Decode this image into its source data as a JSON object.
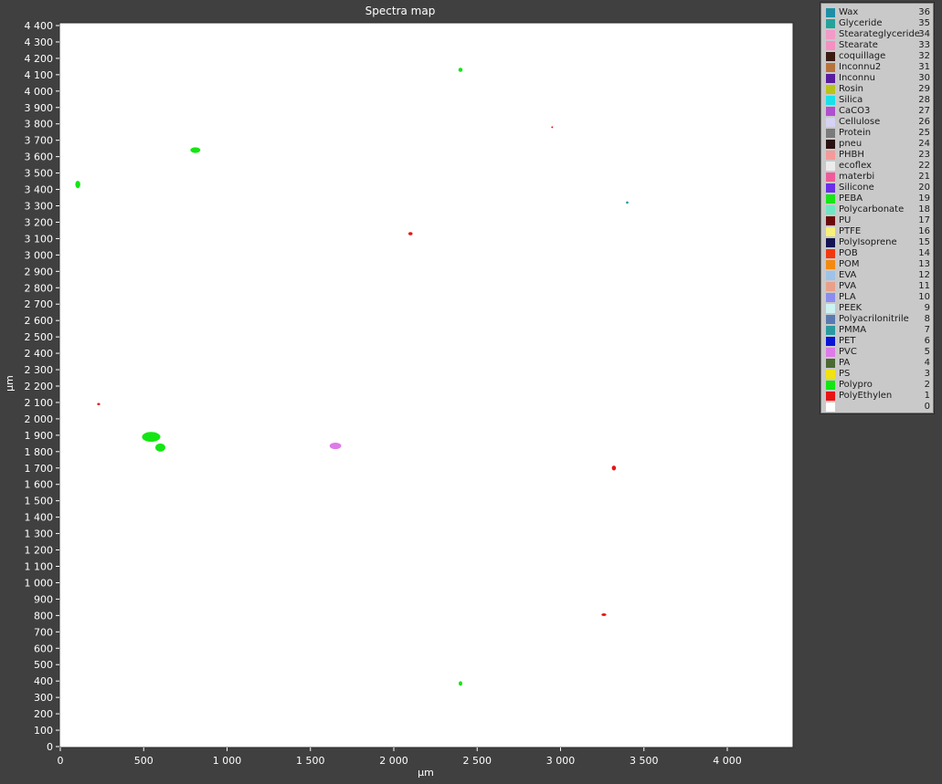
{
  "chart_data": {
    "type": "heatmap",
    "title": "Spectra map",
    "xlabel": "µm",
    "ylabel": "µm",
    "xlim": [
      0,
      4400
    ],
    "ylim": [
      0,
      4400
    ],
    "x_ticks": [
      {
        "value": 0,
        "label": "0"
      },
      {
        "value": 500,
        "label": "500"
      },
      {
        "value": 1000,
        "label": "1 000"
      },
      {
        "value": 1500,
        "label": "1 500"
      },
      {
        "value": 2000,
        "label": "2 000"
      },
      {
        "value": 2500,
        "label": "2 500"
      },
      {
        "value": 3000,
        "label": "3 000"
      },
      {
        "value": 3500,
        "label": "3 500"
      },
      {
        "value": 4000,
        "label": "4 000"
      }
    ],
    "y_ticks": [
      {
        "value": 0,
        "label": "0"
      },
      {
        "value": 100,
        "label": "100"
      },
      {
        "value": 200,
        "label": "200"
      },
      {
        "value": 300,
        "label": "300"
      },
      {
        "value": 400,
        "label": "400"
      },
      {
        "value": 500,
        "label": "500"
      },
      {
        "value": 600,
        "label": "600"
      },
      {
        "value": 700,
        "label": "700"
      },
      {
        "value": 800,
        "label": "800"
      },
      {
        "value": 900,
        "label": "900"
      },
      {
        "value": 1000,
        "label": "1 000"
      },
      {
        "value": 1100,
        "label": "1 100"
      },
      {
        "value": 1200,
        "label": "1 200"
      },
      {
        "value": 1300,
        "label": "1 300"
      },
      {
        "value": 1400,
        "label": "1 400"
      },
      {
        "value": 1500,
        "label": "1 500"
      },
      {
        "value": 1600,
        "label": "1 600"
      },
      {
        "value": 1700,
        "label": "1 700"
      },
      {
        "value": 1800,
        "label": "1 800"
      },
      {
        "value": 1900,
        "label": "1 900"
      },
      {
        "value": 2000,
        "label": "2 000"
      },
      {
        "value": 2100,
        "label": "2 100"
      },
      {
        "value": 2200,
        "label": "2 200"
      },
      {
        "value": 2300,
        "label": "2 300"
      },
      {
        "value": 2400,
        "label": "2 400"
      },
      {
        "value": 2500,
        "label": "2 500"
      },
      {
        "value": 2600,
        "label": "2 600"
      },
      {
        "value": 2700,
        "label": "2 700"
      },
      {
        "value": 2800,
        "label": "2 800"
      },
      {
        "value": 2900,
        "label": "2 900"
      },
      {
        "value": 3000,
        "label": "3 000"
      },
      {
        "value": 3100,
        "label": "3 100"
      },
      {
        "value": 3200,
        "label": "3 200"
      },
      {
        "value": 3300,
        "label": "3 300"
      },
      {
        "value": 3400,
        "label": "3 400"
      },
      {
        "value": 3500,
        "label": "3 500"
      },
      {
        "value": 3600,
        "label": "3 600"
      },
      {
        "value": 3700,
        "label": "3 700"
      },
      {
        "value": 3800,
        "label": "3 800"
      },
      {
        "value": 3900,
        "label": "3 900"
      },
      {
        "value": 4000,
        "label": "4 000"
      },
      {
        "value": 4100,
        "label": "4 100"
      },
      {
        "value": 4200,
        "label": "4 200"
      },
      {
        "value": 4300,
        "label": "4 300"
      },
      {
        "value": 4400,
        "label": "4 400"
      }
    ],
    "background_class": 0,
    "grid": false,
    "legend_position": "right",
    "particles": [
      {
        "class": "Polypro",
        "value": 2,
        "color": "#14e614",
        "x": 2400,
        "y": 4130,
        "w": 25,
        "h": 25
      },
      {
        "class": "PolyEthylen",
        "value": 1,
        "color": "#e81414",
        "x": 2950,
        "y": 3780,
        "w": 8,
        "h": 8
      },
      {
        "class": "Polypro",
        "value": 2,
        "color": "#14e614",
        "x": 810,
        "y": 3640,
        "w": 60,
        "h": 35
      },
      {
        "class": "Polypro",
        "value": 2,
        "color": "#14e614",
        "x": 105,
        "y": 3430,
        "w": 30,
        "h": 45
      },
      {
        "class": "PMMA",
        "value": 7,
        "color": "#2a9aa0",
        "x": 3400,
        "y": 3320,
        "w": 15,
        "h": 15
      },
      {
        "class": "PolyEthylen",
        "value": 1,
        "color": "#e81414",
        "x": 2100,
        "y": 3130,
        "w": 25,
        "h": 20
      },
      {
        "class": "PolyEthylen",
        "value": 1,
        "color": "#e81414",
        "x": 230,
        "y": 2090,
        "w": 18,
        "h": 14
      },
      {
        "class": "Polypro",
        "value": 2,
        "color": "#14e614",
        "x": 545,
        "y": 1890,
        "w": 110,
        "h": 60
      },
      {
        "class": "Polypro",
        "value": 2,
        "color": "#14e614",
        "x": 600,
        "y": 1825,
        "w": 60,
        "h": 50
      },
      {
        "class": "PVC",
        "value": 5,
        "color": "#dd7be8",
        "x": 1650,
        "y": 1835,
        "w": 70,
        "h": 40
      },
      {
        "class": "PolyEthylen",
        "value": 1,
        "color": "#e81414",
        "x": 3320,
        "y": 1700,
        "w": 25,
        "h": 30
      },
      {
        "class": "PolyEthylen",
        "value": 1,
        "color": "#e81414",
        "x": 3260,
        "y": 805,
        "w": 30,
        "h": 16
      },
      {
        "class": "Polypro",
        "value": 2,
        "color": "#14e614",
        "x": 2400,
        "y": 385,
        "w": 22,
        "h": 28
      }
    ],
    "legend": [
      {
        "label": "Wax",
        "value": "36",
        "color": "#1f8fa6"
      },
      {
        "label": "Glyceride",
        "value": "35",
        "color": "#25a39a"
      },
      {
        "label": "Stearateglyceride",
        "value": "34",
        "color": "#f29ac8"
      },
      {
        "label": "Stearate",
        "value": "33",
        "color": "#f590c2"
      },
      {
        "label": "coquillage",
        "value": "32",
        "color": "#3a1c12"
      },
      {
        "label": "Inconnu2",
        "value": "31",
        "color": "#b8733d"
      },
      {
        "label": "Inconnu",
        "value": "30",
        "color": "#5a1c9e"
      },
      {
        "label": "Rosin",
        "value": "29",
        "color": "#b9c41a"
      },
      {
        "label": "Silica",
        "value": "28",
        "color": "#19e0ea"
      },
      {
        "label": "CaCO3",
        "value": "27",
        "color": "#b04fd0"
      },
      {
        "label": "Cellulose",
        "value": "26",
        "color": "#d6d2f2"
      },
      {
        "label": "Protein",
        "value": "25",
        "color": "#7b7b7b"
      },
      {
        "label": "pneu",
        "value": "24",
        "color": "#2a1212"
      },
      {
        "label": "PHBH",
        "value": "23",
        "color": "#f49a9a"
      },
      {
        "label": "ecoflex",
        "value": "22",
        "color": "#ececec"
      },
      {
        "label": "materbi",
        "value": "21",
        "color": "#ee5b9a"
      },
      {
        "label": "Silicone",
        "value": "20",
        "color": "#6a2ee8"
      },
      {
        "label": "PEBA",
        "value": "19",
        "color": "#17e617"
      },
      {
        "label": "Polycarbonate",
        "value": "18",
        "color": "#6fe6c2"
      },
      {
        "label": "PU",
        "value": "17",
        "color": "#6a0a0a"
      },
      {
        "label": "PTFE",
        "value": "16",
        "color": "#f7f07a"
      },
      {
        "label": "PolyIsoprene",
        "value": "15",
        "color": "#141452"
      },
      {
        "label": "POB",
        "value": "14",
        "color": "#f2380e"
      },
      {
        "label": "POM",
        "value": "13",
        "color": "#f28a12"
      },
      {
        "label": "EVA",
        "value": "12",
        "color": "#9fc2e8"
      },
      {
        "label": "PVA",
        "value": "11",
        "color": "#e8a08a"
      },
      {
        "label": "PLA",
        "value": "10",
        "color": "#8c8cf0"
      },
      {
        "label": "PEEK",
        "value": "9",
        "color": "#cdf2f2"
      },
      {
        "label": "Polyacrilonitrile",
        "value": "8",
        "color": "#5a7ab2"
      },
      {
        "label": "PMMA",
        "value": "7",
        "color": "#2a9aa0"
      },
      {
        "label": "PET",
        "value": "6",
        "color": "#0a14d6"
      },
      {
        "label": "PVC",
        "value": "5",
        "color": "#dd7be8"
      },
      {
        "label": "PA",
        "value": "4",
        "color": "#4a6a32"
      },
      {
        "label": "PS",
        "value": "3",
        "color": "#f2e212"
      },
      {
        "label": "Polypro",
        "value": "2",
        "color": "#14e614"
      },
      {
        "label": "PolyEthylen",
        "value": "1",
        "color": "#e81414"
      },
      {
        "label": "",
        "value": "0",
        "color": "#ffffff"
      }
    ]
  }
}
